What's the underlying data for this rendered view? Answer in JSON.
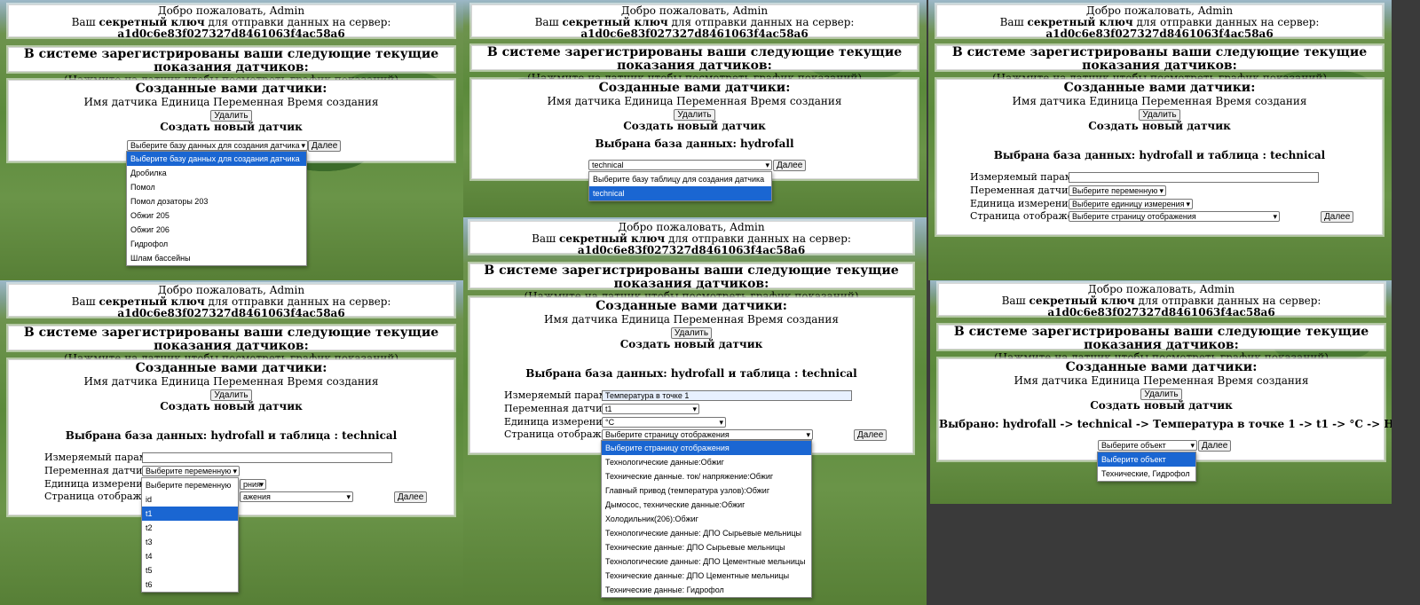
{
  "common": {
    "welcome": "Добро пожаловать, Admin",
    "key_prefix": "Ваш",
    "key_bold": "секретный ключ",
    "key_suffix": "для отправки данных на сервер:",
    "key_value": "a1d0c6e83f027327d8461063f4ac58a6",
    "registered_title": "В системе зарегистрированы ваши следующие текущие показания датчиков:",
    "registered_hint": "(Нажмите на датчик чтобы посмотреть график показаний)",
    "created_title": "Созданные вами датчики:",
    "col_name": "Имя датчика",
    "col_unit": "Единица",
    "col_var": "Переменная",
    "col_time": "Время создания",
    "delete_btn": "Удалить",
    "create_new": "Создать новый датчик",
    "next_btn": "Далее",
    "db_table_selected": "Выбрана база данных: hydrofall и таблица : technical",
    "measured_label": "Измеряемый параметр:",
    "variable_label": "Переменная датчика:",
    "unit_label": "Единица измерения:",
    "page_label": "Страница отображения:",
    "choose_var": "Выберите переменную",
    "choose_unit": "Выберите единицу измерения",
    "choose_page": "Выберите страницу отображения"
  },
  "p1": {
    "db_select": "Выберите базу данных для создания датчика",
    "db_options": [
      "Выберите базу данных для создания датчика",
      "Дробилка",
      "Помол",
      "Помол дозаторы 203",
      "Обжиг 205",
      "Обжиг 206",
      "Гидрофол",
      "Шлам бассейны"
    ]
  },
  "p2": {
    "db_selected": "Выбрана база данных: hydrofall",
    "table_select": "technical",
    "table_options": [
      "Выберите базу таблицу для создания датчика",
      "technical"
    ]
  },
  "p4": {
    "var_options": [
      "Выберите переменную",
      "id",
      "t1",
      "t2",
      "t3",
      "t4",
      "t5",
      "t6"
    ],
    "unit_partial": "рния",
    "page_partial": "ажения"
  },
  "p5": {
    "measured_value": "Температура в точке 1",
    "var_value": "t1",
    "unit_value": "°C",
    "page_options": [
      "Выберите страницу отображения",
      "Технологические данные:Обжиг",
      "Технические данные. ток/ напряжение:Обжиг",
      "Главный привод (температура узлов):Обжиг",
      "Дымосос, технические данные:Обжиг",
      "Холодильник(206):Обжиг",
      "Технологические данные: ДПО Сырьевые мельницы",
      "Технические данные: ДПО Сырьевые мельницы",
      "Технологические данные: ДПО Цементные мельницы",
      "Технические данные: ДПО Цементные мельницы",
      "Технические данные: Гидрофол"
    ]
  },
  "p6": {
    "chosen": "Выбрано: hydrofall -> technical -> Температура в точке 1 -> t1 -> °C -> HYDROFALL",
    "obj_select": "Выберите объект",
    "obj_options": [
      "Выберите объект",
      "Технические, Гидрофол"
    ]
  }
}
